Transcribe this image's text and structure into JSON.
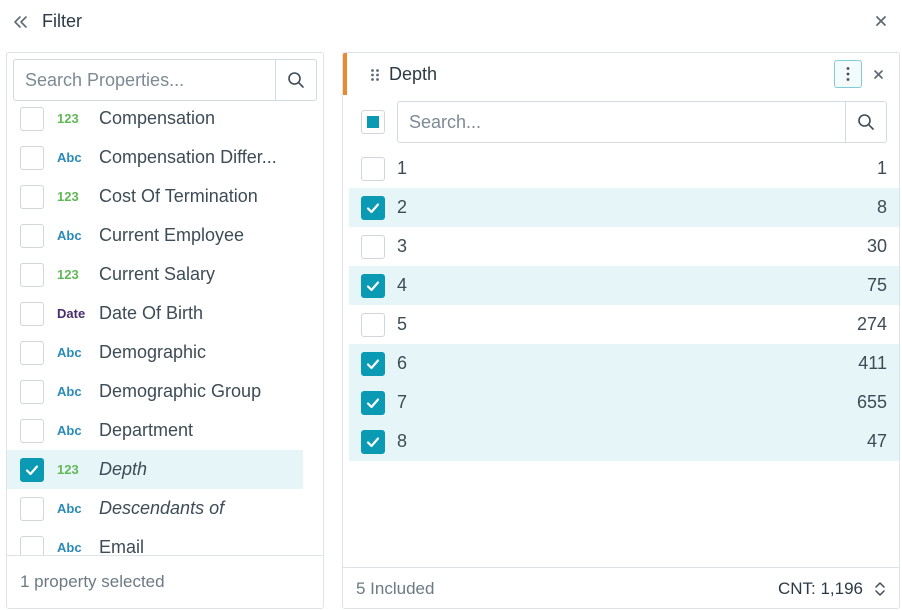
{
  "header": {
    "title": "Filter"
  },
  "left_panel": {
    "search_placeholder": "Search Properties...",
    "properties": [
      {
        "type": "123",
        "label": "Compensation",
        "checked": false,
        "italic": false
      },
      {
        "type": "Abc",
        "label": "Compensation Differ...",
        "checked": false,
        "italic": false
      },
      {
        "type": "123",
        "label": "Cost Of Termination",
        "checked": false,
        "italic": false
      },
      {
        "type": "Abc",
        "label": "Current Employee",
        "checked": false,
        "italic": false
      },
      {
        "type": "123",
        "label": "Current Salary",
        "checked": false,
        "italic": false
      },
      {
        "type": "Date",
        "label": "Date Of Birth",
        "checked": false,
        "italic": false
      },
      {
        "type": "Abc",
        "label": "Demographic",
        "checked": false,
        "italic": false
      },
      {
        "type": "Abc",
        "label": "Demographic Group",
        "checked": false,
        "italic": false
      },
      {
        "type": "Abc",
        "label": "Department",
        "checked": false,
        "italic": false
      },
      {
        "type": "123",
        "label": "Depth",
        "checked": true,
        "italic": true
      },
      {
        "type": "Abc",
        "label": "Descendants of",
        "checked": false,
        "italic": true
      },
      {
        "type": "Abc",
        "label": "Email",
        "checked": false,
        "italic": false
      }
    ],
    "footer_text": "1 property selected"
  },
  "right_panel": {
    "title": "Depth",
    "search_placeholder": "Search...",
    "values": [
      {
        "label": "1",
        "count": "1",
        "checked": false
      },
      {
        "label": "2",
        "count": "8",
        "checked": true
      },
      {
        "label": "3",
        "count": "30",
        "checked": false
      },
      {
        "label": "4",
        "count": "75",
        "checked": true
      },
      {
        "label": "5",
        "count": "274",
        "checked": false
      },
      {
        "label": "6",
        "count": "411",
        "checked": true
      },
      {
        "label": "7",
        "count": "655",
        "checked": true
      },
      {
        "label": "8",
        "count": "47",
        "checked": true
      }
    ],
    "footer_included": "5 Included",
    "footer_count": "CNT: 1,196"
  },
  "colors": {
    "accent": "#0a9ab4",
    "selected_row": "#e6f5f8",
    "accent_bar": "#e88a2e",
    "number_type": "#62b858",
    "text_type": "#2a8ab8",
    "date_type": "#4a2d6e"
  },
  "icons": {
    "collapse": "double-chevron-left-icon",
    "close": "close-icon",
    "search": "search-icon",
    "drag": "drag-handle-icon",
    "more": "more-vertical-icon",
    "sort": "sort-icon",
    "check": "check-icon"
  }
}
